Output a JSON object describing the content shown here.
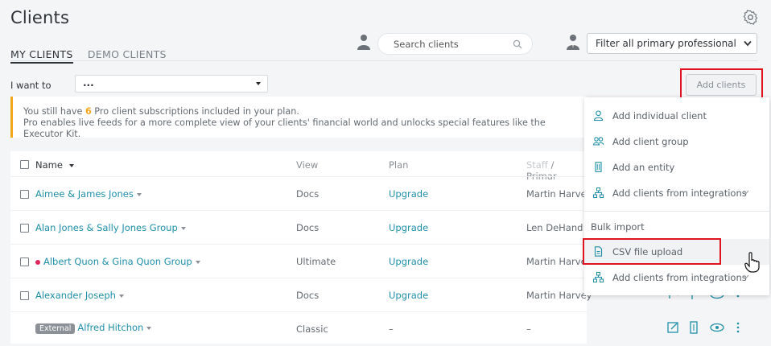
{
  "header": {
    "title": "Clients"
  },
  "tabs": [
    {
      "label": "MY CLIENTS"
    },
    {
      "label": "DEMO CLIENTS"
    }
  ],
  "search": {
    "placeholder": "Search clients"
  },
  "filter": {
    "selected": "Filter all primary professional"
  },
  "iwant": {
    "label": "I want to",
    "selected": "..."
  },
  "add_clients": {
    "label": "Add clients"
  },
  "banner": {
    "line1_pre": "You still have ",
    "count": "6",
    "line1_post": " Pro client subscriptions included in your plan.",
    "line2": "Pro enables live feeds for a more complete view of your clients' financial world and unlocks special features like the Executor Kit."
  },
  "table": {
    "columns": {
      "name": "Name",
      "view": "View",
      "plan": "Plan",
      "staff": "Staff",
      "primary": "/ Primar"
    },
    "rows": [
      {
        "name": "Aimee & James Jones",
        "view": "Docs",
        "plan": "Upgrade",
        "staff": "Martin Harve"
      },
      {
        "name": "Alan Jones & Sally Jones Group",
        "view": "Docs",
        "plan": "Upgrade",
        "staff": "Len DeHand"
      },
      {
        "name": "Albert Quon & Gina Quon Group",
        "view": "Ultimate",
        "plan": "Upgrade",
        "staff": "Martin Harve"
      },
      {
        "name": "Alexander Joseph",
        "view": "Docs",
        "plan": "Upgrade",
        "staff": "Martin Harvey"
      },
      {
        "badge": "External",
        "name": "Alfred Hitchon",
        "view": "Classic",
        "plan": "–",
        "staff": "–"
      }
    ]
  },
  "menu": {
    "items": [
      {
        "label": "Add individual client",
        "icon": "person-icon"
      },
      {
        "label": "Add client group",
        "icon": "group-icon"
      },
      {
        "label": "Add an entity",
        "icon": "building-icon"
      },
      {
        "label": "Add clients from integrations",
        "icon": "integration-icon"
      }
    ],
    "bulk_label": "Bulk import",
    "bulk_items": [
      {
        "label": "CSV file upload",
        "icon": "file-icon"
      },
      {
        "label": "Add clients from integrations",
        "icon": "integration-icon"
      }
    ]
  },
  "colors": {
    "accent": "#1f8fa8",
    "warning": "#f2a71a",
    "highlight": "#e0141e"
  }
}
